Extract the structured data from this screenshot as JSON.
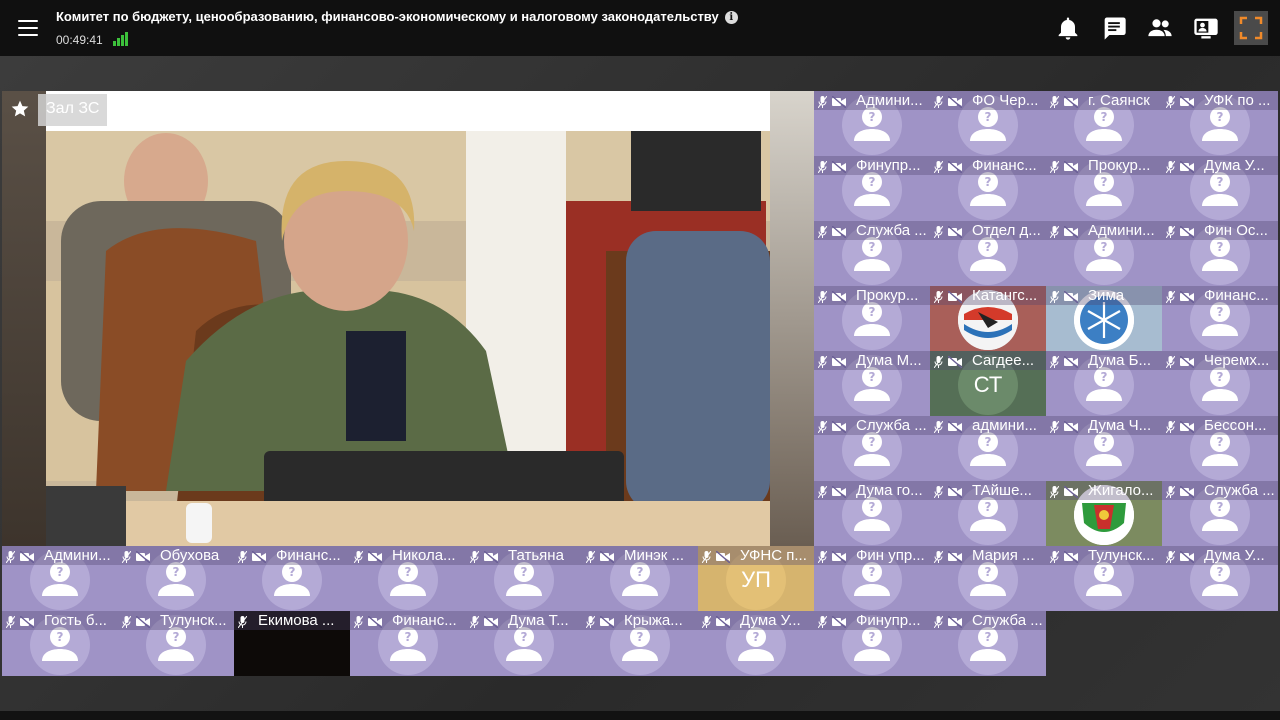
{
  "header": {
    "title": "Комитет по бюджету, ценообразованию, финансово-экономическому и налоговому законодательству",
    "timer": "00:49:41",
    "icons": [
      "menu-icon",
      "info-icon",
      "signal-icon",
      "bell-icon",
      "chat-icon",
      "participants-icon",
      "screen-share-icon",
      "fullscreen-icon"
    ],
    "signal_color": "#3cc13b",
    "fullscreen_color": "#f08a2a"
  },
  "main_video": {
    "label": "Зал ЗС",
    "icon": "star-icon"
  },
  "tile_color": "#9f93c6",
  "grid_right": [
    [
      "Админи...",
      "ФО Чер...",
      "г. Саянск",
      "УФК по ..."
    ],
    [
      "Финупр...",
      "Финанс...",
      "Прокур...",
      "Дума У..."
    ],
    [
      "Служба ...",
      "Отдел д...",
      "Админи...",
      "Фин Ос..."
    ],
    [
      "Прокур...",
      "Катангс...",
      "Зима",
      "Финанс..."
    ],
    [
      "Дума М...",
      "Сагдее...",
      "Дума Б...",
      "Черемх..."
    ],
    [
      "Служба ...",
      "админи...",
      "Дума Ч...",
      "Бессон..."
    ],
    [
      "Дума го...",
      "ТАйше...",
      "Жигало...",
      "Служба ..."
    ]
  ],
  "row8": [
    "Админи...",
    "Обухова",
    "Финанс...",
    "Никола...",
    "Татьяна",
    "Минэк ...",
    "УФНС п...",
    "Фин упр...",
    "Мария ...",
    "Тулунск...",
    "Дума У..."
  ],
  "row9": [
    "Гость б...",
    "Тулунск...",
    "Екимова ...",
    "Финанс...",
    "Дума Т...",
    "Крыжа...",
    "Дума У...",
    "Финупр...",
    "Служба ..."
  ],
  "initials": {
    "sagdeev": "СТ",
    "ufns": "УП"
  }
}
